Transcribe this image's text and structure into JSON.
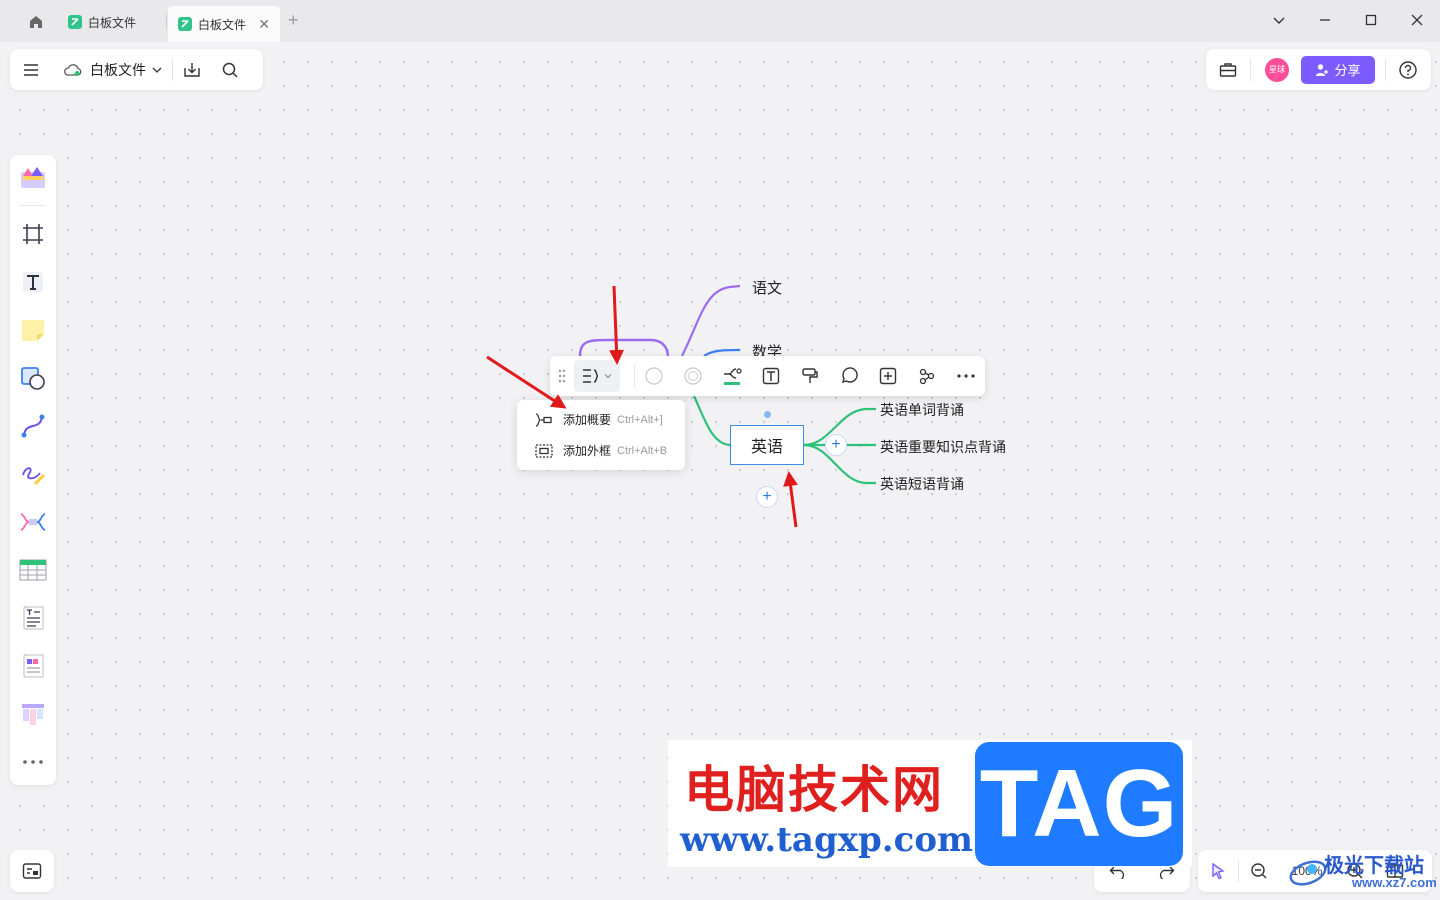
{
  "tabs": [
    {
      "label": "白板文件"
    },
    {
      "label": "白板文件"
    }
  ],
  "file": {
    "name": "白板文件"
  },
  "share": {
    "label": "分享"
  },
  "avatar": {
    "text": "星球"
  },
  "mindmap": {
    "branches": [
      "语文",
      "数学",
      "英语"
    ],
    "english_children": [
      "英语单词背诵",
      "英语重要知识点背诵",
      "英语短语背诵"
    ]
  },
  "dropdown": {
    "items": [
      {
        "label": "添加概要",
        "shortcut": "Ctrl+Alt+]"
      },
      {
        "label": "添加外框",
        "shortcut": "Ctrl+Alt+B"
      }
    ]
  },
  "zoom": {
    "value": "100%"
  },
  "watermark": {
    "title": "电脑技术网",
    "url": "www.tagxp.com",
    "tag": "TAG",
    "site2": "极光下载站",
    "site2_url": "www.xz7.com"
  },
  "colors": {
    "accent": "#7c5cff",
    "branch_purple": "#9b6cf0",
    "branch_blue": "#3c7ff0",
    "branch_green": "#2fc07a",
    "selection_blue": "#3c8de8",
    "arrow_red": "#e01a1a"
  },
  "icons": [
    "home-icon",
    "whiteboard-logo-icon",
    "close-icon",
    "plus-icon",
    "chevron-down-icon",
    "minimize-icon",
    "maximize-icon",
    "window-close-icon",
    "menu-icon",
    "cloud-icon",
    "download-icon",
    "search-icon",
    "toolbox-icon",
    "add-user-icon",
    "help-icon",
    "template-icon",
    "frame-icon",
    "text-icon",
    "sticky-note-icon",
    "shape-icon",
    "connector-icon",
    "pen-icon",
    "mindmap-icon",
    "table-icon",
    "document-icon",
    "card-icon",
    "kanban-icon",
    "more-icon",
    "map-icon",
    "undo-icon",
    "redo-icon",
    "select-icon",
    "zoom-out-icon",
    "zoom-in-icon",
    "fit-icon"
  ]
}
